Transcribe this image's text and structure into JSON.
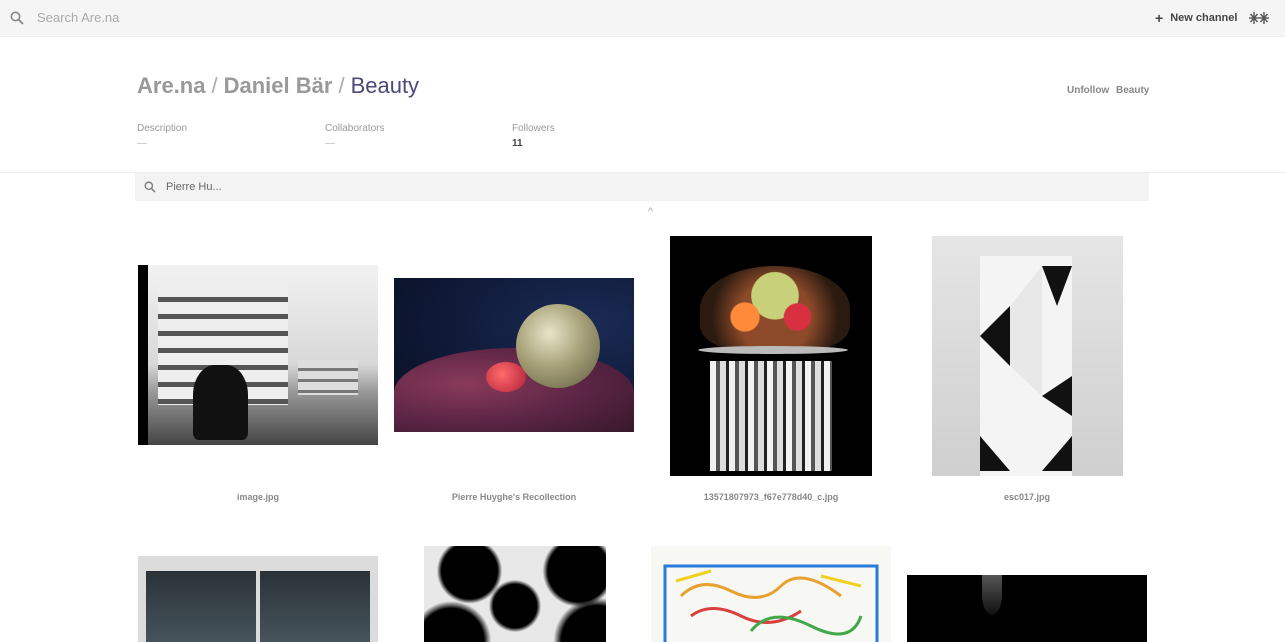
{
  "topbar": {
    "search_placeholder": "Search Are.na",
    "new_channel_label": "New channel",
    "plus_icon": "plus-icon",
    "logo_icon": "arena-logo-icon"
  },
  "breadcrumb": {
    "root": "Are.na",
    "separator": "/",
    "user": "Daniel Bär",
    "channel": "Beauty"
  },
  "actions": {
    "unfollow": "Unfollow",
    "channel": "Beauty"
  },
  "meta": {
    "description_label": "Description",
    "description_value": "—",
    "collaborators_label": "Collaborators",
    "collaborators_value": "—",
    "followers_label": "Followers",
    "followers_value": "11"
  },
  "filter": {
    "query": "Pierre Hu..."
  },
  "caret": "^",
  "blocks": [
    {
      "title": "image.jpg"
    },
    {
      "title": "Pierre Huyghe's Recollection"
    },
    {
      "title": "13571807973_f67e778d40_c.jpg"
    },
    {
      "title": "esc017.jpg"
    }
  ]
}
